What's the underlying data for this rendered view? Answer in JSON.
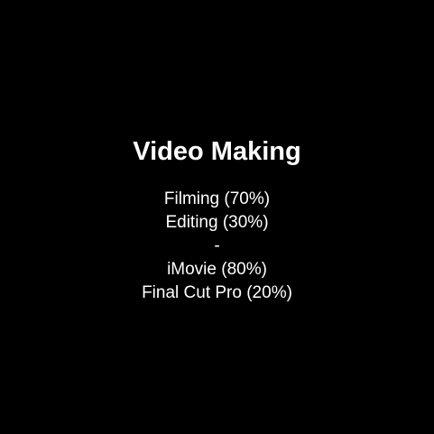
{
  "title": "Video Making",
  "lines": [
    "Filming (70%)",
    "Editing (30%)",
    "-",
    "iMovie (80%)",
    "Final Cut Pro (20%)"
  ],
  "colors": {
    "background": "#000000",
    "text": "#ffffff"
  }
}
